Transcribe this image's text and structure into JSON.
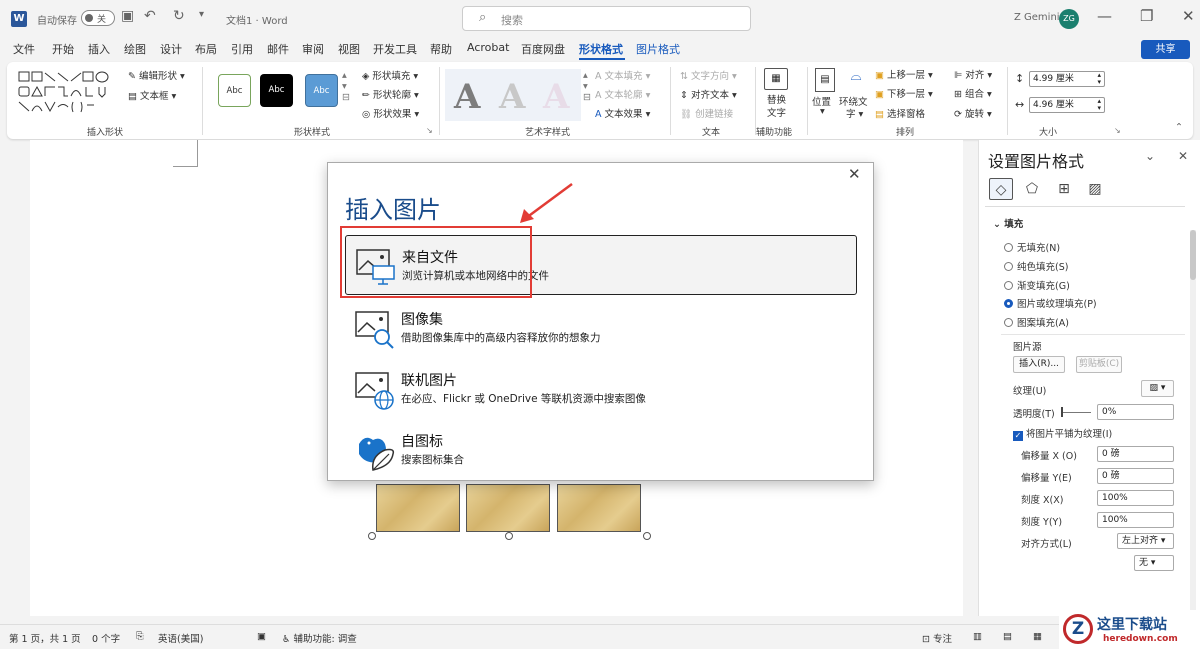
{
  "titlebar": {
    "autosave_label": "自动保存",
    "autosave_state": "关",
    "doc_title": "文档1 · Word",
    "search_placeholder": "搜索",
    "user_name": "Z Gemini",
    "user_initials": "ZG"
  },
  "menu": {
    "items": [
      "文件",
      "开始",
      "插入",
      "绘图",
      "设计",
      "布局",
      "引用",
      "邮件",
      "审阅",
      "视图",
      "开发工具",
      "帮助",
      "Acrobat",
      "百度网盘",
      "形状格式",
      "图片格式"
    ],
    "active": "形状格式",
    "share": "共享"
  },
  "ribbon": {
    "insert_shapes": {
      "edit_shape": "编辑形状",
      "text_box": "文本框",
      "label": "插入形状"
    },
    "shape_styles": {
      "samples": [
        "Abc",
        "Abc",
        "Abc"
      ],
      "fill": "形状填充",
      "outline": "形状轮廓",
      "effects": "形状效果",
      "label": "形状样式"
    },
    "wordart": {
      "text_fill": "文本填充",
      "text_outline": "文本轮廓",
      "text_effects": "文本效果",
      "label": "艺术字样式"
    },
    "text": {
      "direction": "文字方向",
      "align": "对齐文本",
      "link": "创建链接",
      "label": "文本"
    },
    "accessibility": {
      "alt_text_1": "替换",
      "alt_text_2": "文字",
      "label": "辅助功能"
    },
    "arrange": {
      "position": "位置",
      "wrap_1": "环绕文",
      "wrap_2": "字",
      "bring_forward": "上移一层",
      "send_backward": "下移一层",
      "selection_pane": "选择窗格",
      "align": "对齐",
      "group": "组合",
      "rotate": "旋转",
      "label": "排列"
    },
    "size": {
      "height": "4.99 厘米",
      "width": "4.96 厘米",
      "label": "大小"
    }
  },
  "pane": {
    "title": "设置图片格式",
    "section": "填充",
    "fill_options": [
      "无填充(N)",
      "纯色填充(S)",
      "渐变填充(G)",
      "图片或纹理填充(P)",
      "图案填充(A)"
    ],
    "selected_fill": 3,
    "picture_source": "图片源",
    "insert_btn": "插入(R)...",
    "clipboard_btn": "剪贴板(C)",
    "texture_label": "纹理(U)",
    "transparency_label": "透明度(T)",
    "transparency_value": "0%",
    "tile_label": "将图片平铺为纹理(I)",
    "offset_x_label": "偏移量 X (O)",
    "offset_x_value": "0 磅",
    "offset_y_label": "偏移量 Y(E)",
    "offset_y_value": "0 磅",
    "scale_x_label": "刻度 X(X)",
    "scale_x_value": "100%",
    "scale_y_label": "刻度 Y(Y)",
    "scale_y_value": "100%",
    "align_label": "对齐方式(L)",
    "align_value": "左上对齐",
    "mirror_value": "无"
  },
  "dialog": {
    "title": "插入图片",
    "options": [
      {
        "title": "来自文件",
        "desc": "浏览计算机或本地网络中的文件"
      },
      {
        "title": "图像集",
        "desc": "借助图像集库中的高级内容释放你的想象力"
      },
      {
        "title": "联机图片",
        "desc": "在必应、Flickr 或 OneDrive 等联机资源中搜索图像"
      },
      {
        "title": "自图标",
        "desc": "搜索图标集合"
      }
    ]
  },
  "status": {
    "page": "第 1 页，共 1 页",
    "words": "0 个字",
    "language": "英语(美国)",
    "accessibility": "辅助功能: 调查",
    "focus": "专注"
  },
  "watermark": {
    "site": "这里下载站",
    "url": "heredown.com"
  },
  "colors": {
    "accent": "#185abd",
    "highlight": "#e23c35"
  }
}
